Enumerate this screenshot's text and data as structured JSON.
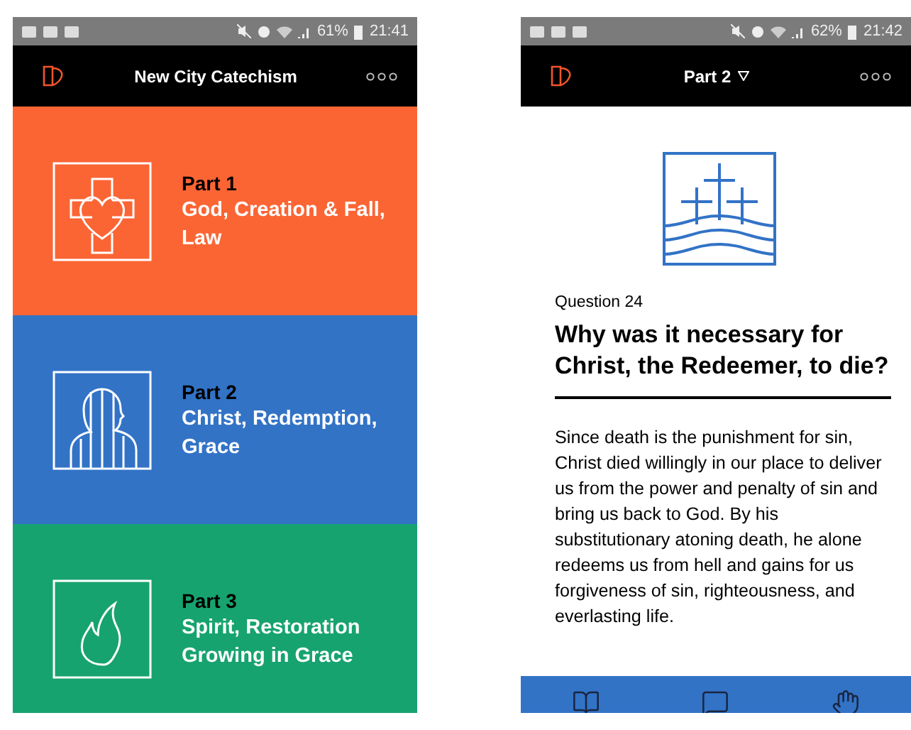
{
  "home_screen": {
    "status_bar": {
      "battery": "61%",
      "time": "21:41"
    },
    "header": {
      "title": "New City Catechism"
    },
    "parts": [
      {
        "label": "Part 1",
        "title": "God, Creation & Fall, Law",
        "color": "#fb6534"
      },
      {
        "label": "Part 2",
        "title": "Christ, Redemption, Grace",
        "color": "#3273c6"
      },
      {
        "label": "Part 3",
        "title": "Spirit, Restoration Growing in Grace",
        "color": "#17a370"
      }
    ]
  },
  "question_screen": {
    "status_bar": {
      "battery": "62%",
      "time": "21:42"
    },
    "header": {
      "title": "Part 2"
    },
    "question": {
      "number": "Question 24",
      "title": "Why was it necessary for Christ, the Redeemer, to die?",
      "answer": "Since death is the punishment for sin, Christ died willingly in our place to deliver us from the power and penalty of sin and bring us back to God. By his substitutionary atoning death, he alone redeems us from hell and gains for us forgiveness of sin, righteousness, and everlasting life."
    }
  }
}
